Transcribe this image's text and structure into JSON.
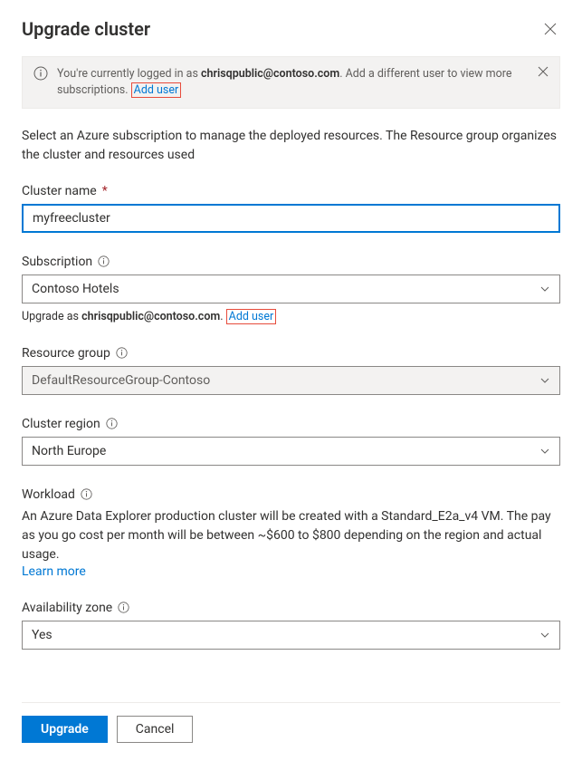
{
  "header": {
    "title": "Upgrade cluster"
  },
  "banner": {
    "prefix": "You're currently logged in as ",
    "email": "chrisqpublic@contoso.com",
    "suffix": ". Add a different user to view more subscriptions. ",
    "add_user": "Add user"
  },
  "description": "Select an Azure subscription to manage the deployed resources. The Resource group organizes the cluster and resources used",
  "fields": {
    "cluster_name": {
      "label": "Cluster name",
      "value": "myfreecluster"
    },
    "subscription": {
      "label": "Subscription",
      "value": "Contoso Hotels",
      "helper_prefix": "Upgrade as ",
      "helper_email": "chrisqpublic@contoso.com",
      "helper_suffix": ". ",
      "add_user": "Add user"
    },
    "resource_group": {
      "label": "Resource group",
      "value": "DefaultResourceGroup-Contoso"
    },
    "cluster_region": {
      "label": "Cluster region",
      "value": "North Europe"
    },
    "workload": {
      "label": "Workload",
      "description": "An Azure Data Explorer production cluster will be created with a Standard_E2a_v4 VM. The pay as you go cost per month will be between ~$600 to $800 depending on the region and actual usage.",
      "learn_more": "Learn more"
    },
    "availability_zone": {
      "label": "Availability zone",
      "value": "Yes"
    }
  },
  "buttons": {
    "primary": "Upgrade",
    "secondary": "Cancel"
  }
}
